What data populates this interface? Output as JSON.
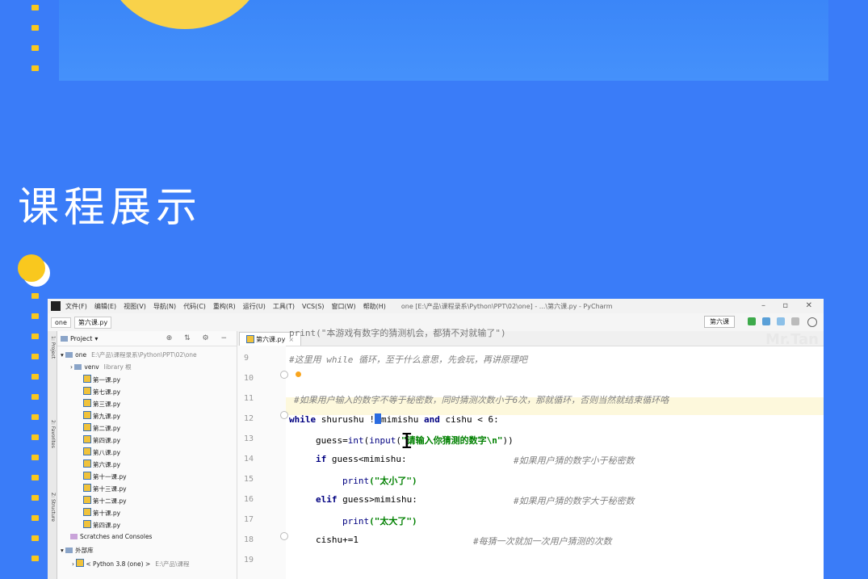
{
  "section_title": "课程展示",
  "ide": {
    "menu": [
      "文件(F)",
      "编辑(E)",
      "视图(V)",
      "导航(N)",
      "代码(C)",
      "重构(R)",
      "运行(U)",
      "工具(T)",
      "VCS(S)",
      "窗口(W)",
      "帮助(H)"
    ],
    "window_title": "one [E:\\产品\\课程录系\\Python\\PPT\\02\\one] - ...\\第六课.py - PyCharm",
    "breadcrumb": [
      "one",
      "第六课.py"
    ],
    "run_config": "第六课",
    "project_label": "Project",
    "root": "one",
    "root_path": "E:\\产品\\课程录系\\Python\\PPT\\02\\one",
    "venv": "venv",
    "venv_suffix": "library 根",
    "files": [
      "第一课.py",
      "第七课.py",
      "第三课.py",
      "第九课.py",
      "第二课.py",
      "第四课.py",
      "第八课.py",
      "第六课.py",
      "第十一课.py",
      "第十三课.py",
      "第十二课.py",
      "第十课.py",
      "第四课.py"
    ],
    "scratches": "Scratches and Consoles",
    "external": "外部库",
    "python_sdk": "< Python 3.8 (one) >",
    "python_path": "E:\\产品\\课程",
    "vtabs": [
      "1: Project",
      "2: Favorites",
      "Z: Structure"
    ],
    "editor_tab": "第六课.py",
    "watermark": "Mr.Tan",
    "line_numbers": [
      "9",
      "10",
      "11",
      "12",
      "13",
      "14",
      "15",
      "16",
      "17",
      "18",
      "19"
    ],
    "code": {
      "l8": "print(\"本游戏有数字的猜测机会，都猜不对就输了\")",
      "l9": "#这里用 while 循环，至于什么意思，先会玩，再讲原理吧",
      "l11": "#如果用户输入的数字不等于秘密数，同时猜测次数小于6次，那就循环，否则当然就结束循环咯",
      "l12_kw": "while",
      "l12_a": " shurushu !",
      "l12_b": "mimishu ",
      "l12_and": "and",
      "l12_c": " cishu < 6:",
      "l13_a": "guess=",
      "l13_fn": "int",
      "l13_b": "(",
      "l13_fn2": "input",
      "l13_c": "(",
      "l13_str": "\"请输入你猜测的数字\\n\"",
      "l13_d": "))",
      "l14_kw": "if",
      "l14_a": " guess<mimishu:",
      "l14_cmt": "#如果用户猜的数字小于秘密数",
      "l15_fn": "print",
      "l15_str": "(\"太小了\")",
      "l16_kw": "elif",
      "l16_a": " guess>mimishu:",
      "l16_cmt": "#如果用户猜的数字大于秘密数",
      "l17_fn": "print",
      "l17_str": "(\"太大了\")",
      "l18_a": "cishu+=1",
      "l18_cmt": "#每猜一次就加一次用户猜测的次数"
    }
  },
  "colors": {
    "background": "#3a7cf8",
    "accent_yellow": "#f9c81e",
    "keyword": "#000080",
    "string": "#008000",
    "comment": "#808080"
  }
}
